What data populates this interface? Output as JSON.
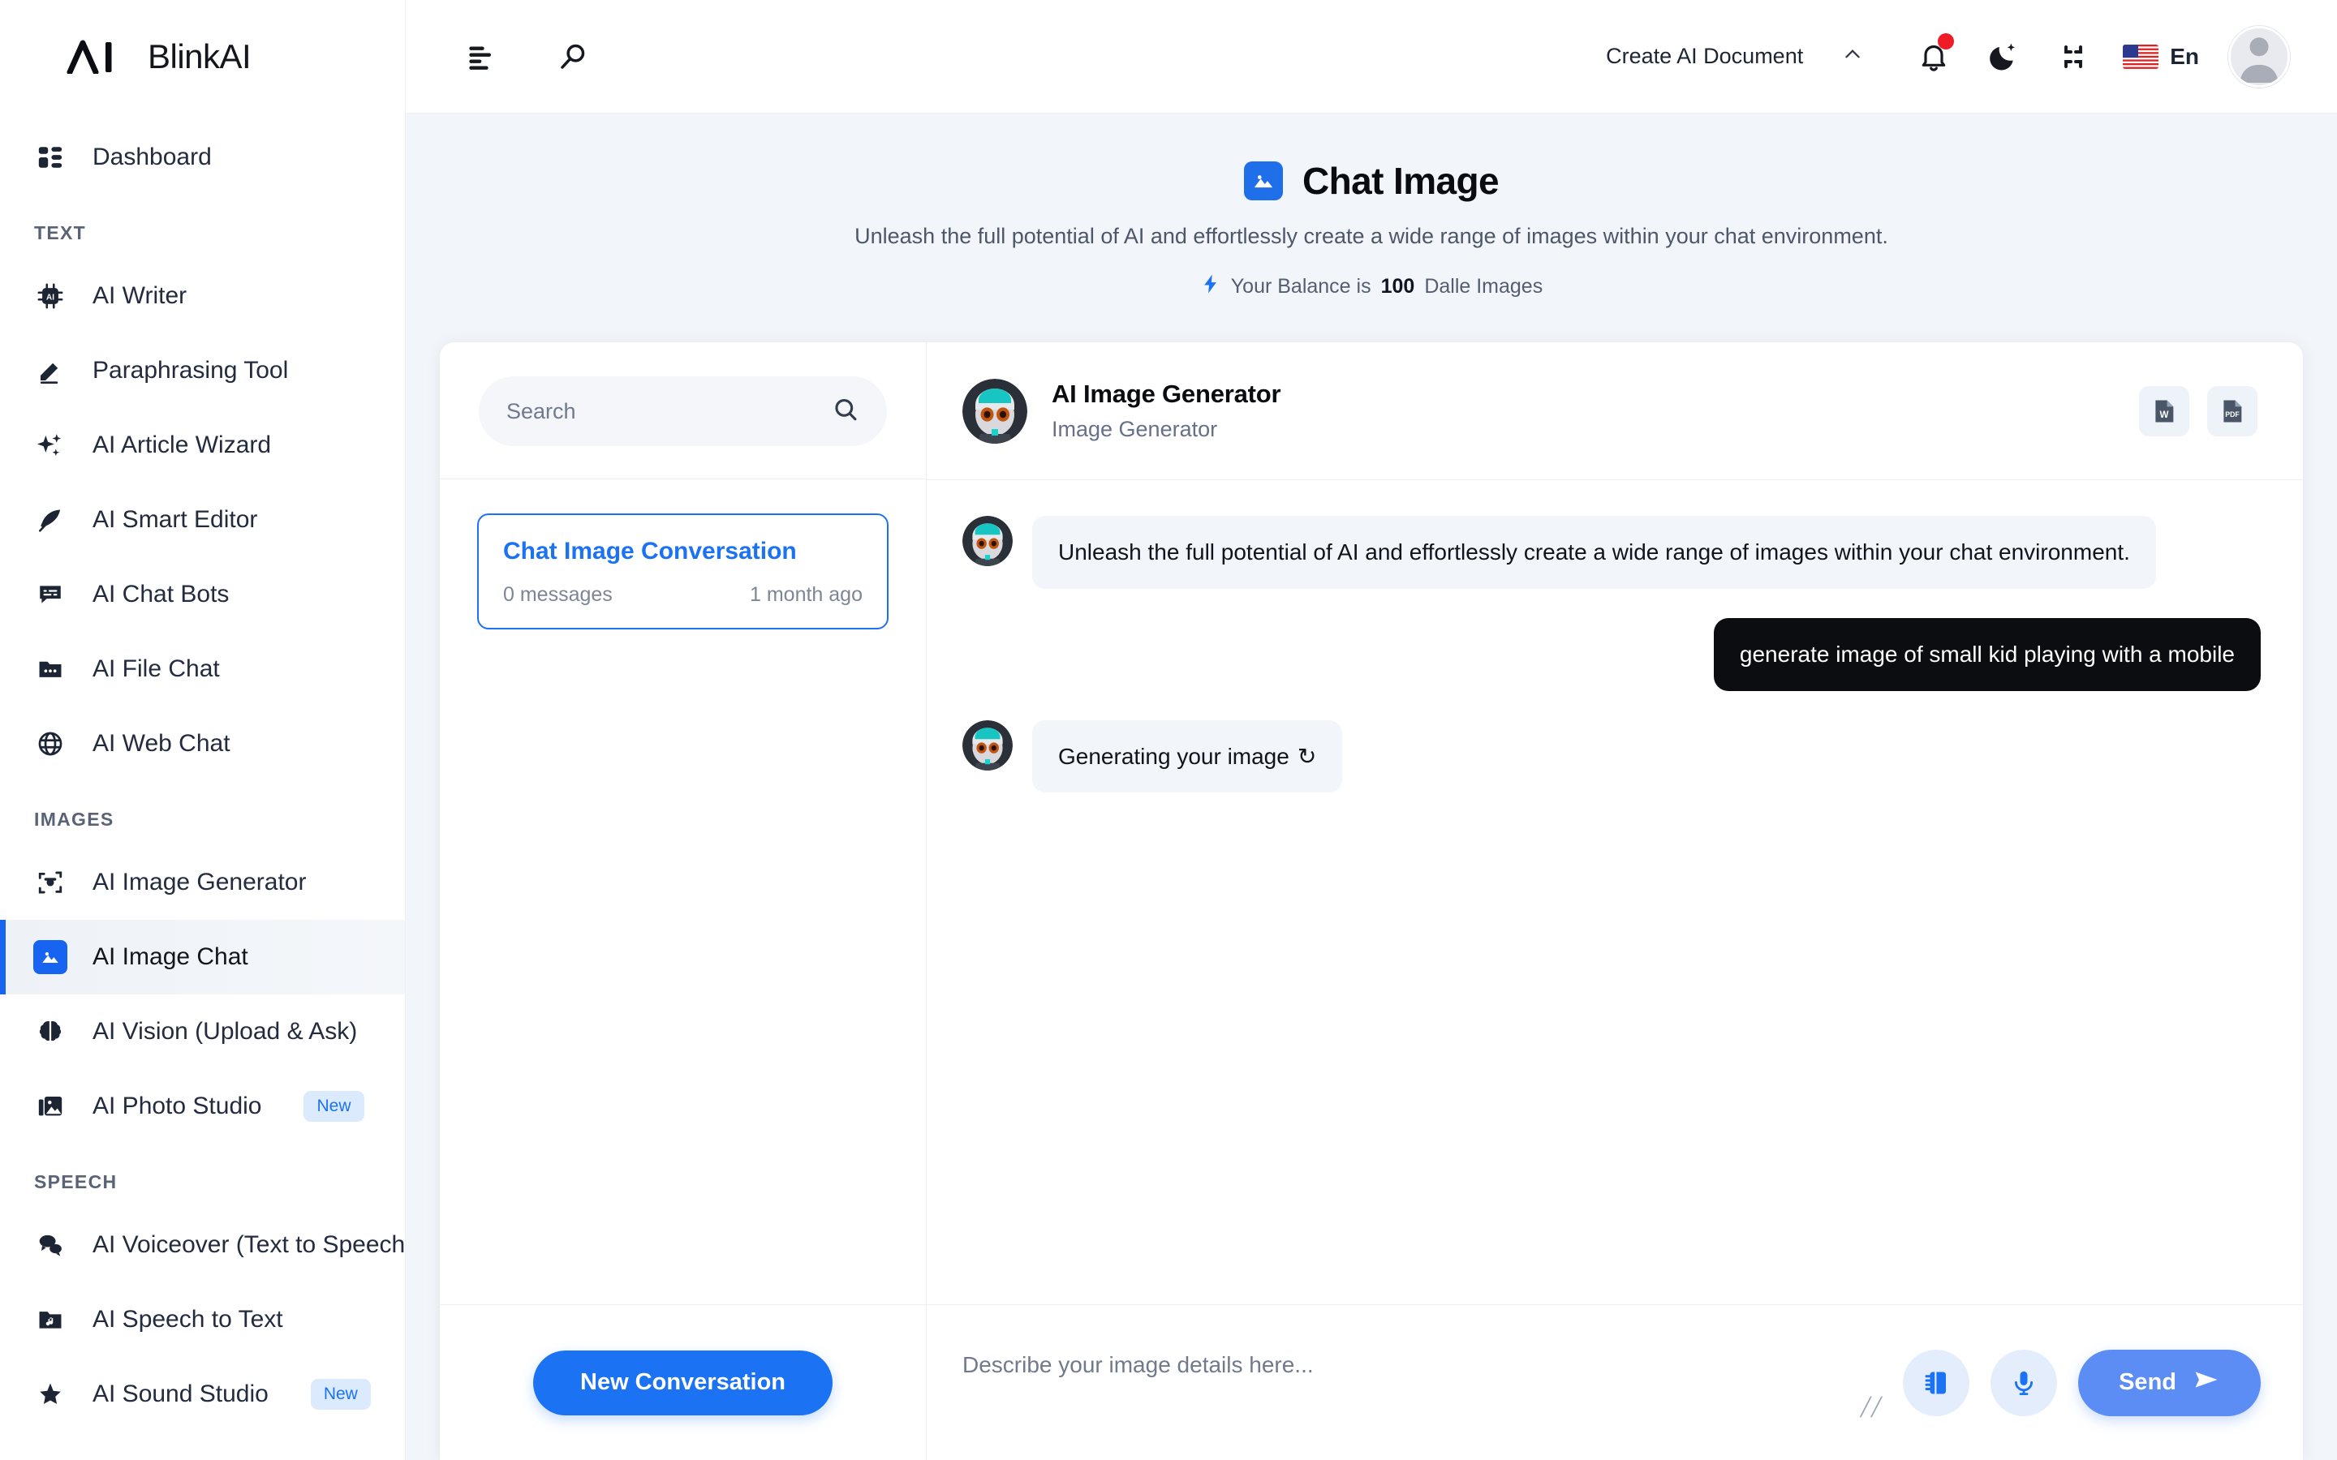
{
  "brand": {
    "logo_text": "BlinkAI",
    "logo_mark": "ai-lambda-mark"
  },
  "header": {
    "menu_icon": "hamburger-menu-icon",
    "search_icon": "search-icon",
    "create_document_label": "Create AI Document",
    "chevron": "⌃",
    "notification_icon": "bell-icon",
    "dark_mode_icon": "moon-icon",
    "fullscreen_icon": "compress-icon",
    "language_label": "En",
    "flag_icon": "us-flag-icon",
    "avatar_icon": "user-avatar-icon"
  },
  "sidebar": {
    "items": [
      {
        "label": "Dashboard",
        "icon": "dashboard-grid-icon",
        "group": null,
        "active": false,
        "badge": null
      },
      {
        "label": "AI Writer",
        "icon": "chip-ai-icon",
        "group": "TEXT",
        "active": false,
        "badge": null
      },
      {
        "label": "Paraphrasing Tool",
        "icon": "pencil-icon",
        "group": null,
        "active": false,
        "badge": null
      },
      {
        "label": "AI Article Wizard",
        "icon": "sparkles-icon",
        "group": null,
        "active": false,
        "badge": null
      },
      {
        "label": "AI Smart Editor",
        "icon": "feather-icon",
        "group": null,
        "active": false,
        "badge": null
      },
      {
        "label": "AI Chat Bots",
        "icon": "chat-bubble-icon",
        "group": null,
        "active": false,
        "badge": null
      },
      {
        "label": "AI File Chat",
        "icon": "folder-icon",
        "group": null,
        "active": false,
        "badge": null
      },
      {
        "label": "AI Web Chat",
        "icon": "globe-icon",
        "group": null,
        "active": false,
        "badge": null
      },
      {
        "label": "AI Image Generator",
        "icon": "camera-frame-icon",
        "group": "IMAGES",
        "active": false,
        "badge": null
      },
      {
        "label": "AI Image Chat",
        "icon": "image-icon",
        "group": null,
        "active": true,
        "badge": null
      },
      {
        "label": "AI Vision (Upload & Ask)",
        "icon": "brain-icon",
        "group": null,
        "active": false,
        "badge": null
      },
      {
        "label": "AI Photo Studio",
        "icon": "photo-stack-icon",
        "group": null,
        "active": false,
        "badge": "New"
      },
      {
        "label": "AI Voiceover (Text to Speech)",
        "icon": "speech-bubbles-icon",
        "group": "SPEECH",
        "active": false,
        "badge": null
      },
      {
        "label": "AI Speech to Text",
        "icon": "music-folder-icon",
        "group": null,
        "active": false,
        "badge": null
      },
      {
        "label": "AI Sound Studio",
        "icon": "star-icon",
        "group": null,
        "active": false,
        "badge": "New"
      }
    ]
  },
  "page": {
    "icon": "image-icon",
    "title": "Chat Image",
    "subtitle": "Unleash the full potential of AI and effortlessly create a wide range of images within your chat environment.",
    "balance_icon": "lightning-bolt-icon",
    "balance_prefix": "Your Balance is",
    "balance_amount": "100",
    "balance_suffix": "Dalle Images"
  },
  "conversations": {
    "search_placeholder": "Search",
    "search_value": "",
    "search_icon": "search-icon",
    "items": [
      {
        "name": "Chat Image Conversation",
        "messages": "0 messages",
        "time": "1 month ago",
        "active": true
      }
    ],
    "new_conversation_label": "New Conversation"
  },
  "chat": {
    "bot_name": "AI Image Generator",
    "bot_role": "Image Generator",
    "bot_avatar": "robot-avatar-icon",
    "export_word_icon": "word-file-icon",
    "export_word_label": "W",
    "export_pdf_icon": "pdf-file-icon",
    "export_pdf_label": "PDF",
    "messages": [
      {
        "from": "bot",
        "text": "Unleash the full potential of AI and effortlessly create a wide range of images within your chat environment."
      },
      {
        "from": "user",
        "text": "generate image of small kid playing with a mobile"
      },
      {
        "from": "bot",
        "text": "Generating your image",
        "spinner": "↻"
      }
    ],
    "composer": {
      "placeholder": "Describe your image details here...",
      "value": "",
      "template_icon": "notebook-icon",
      "mic_icon": "microphone-icon",
      "send_label": "Send",
      "send_icon": "paper-plane-icon",
      "resize_grip": "╱╱"
    }
  },
  "colors": {
    "accent": "#1b72f2",
    "send": "#5b8df5",
    "bg": "#f2f5f9",
    "dark_bubble": "#0c0d10",
    "badge_red": "#ef1b26"
  }
}
